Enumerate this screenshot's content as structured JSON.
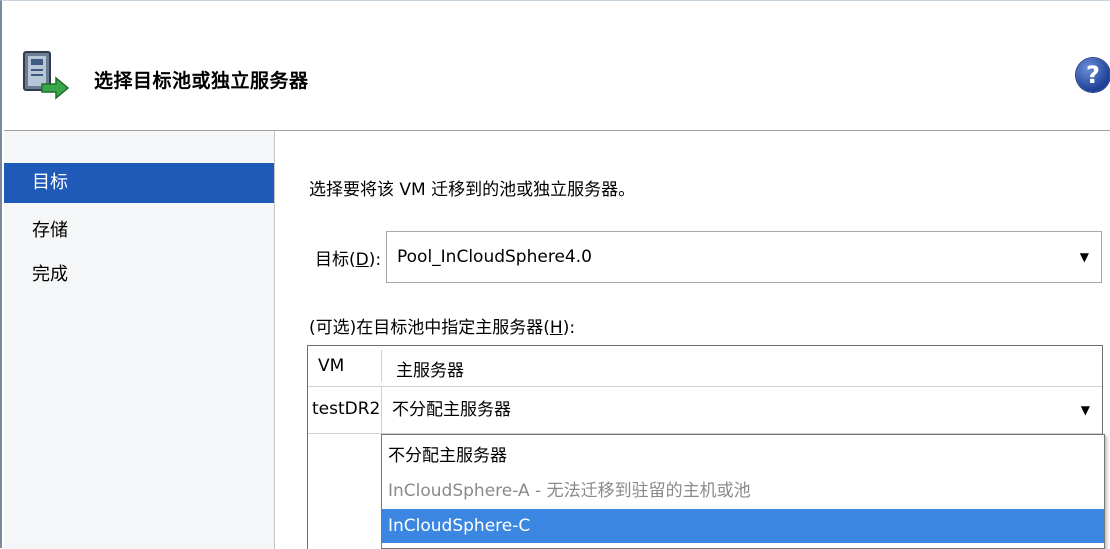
{
  "header": {
    "title": "选择目标池或独立服务器",
    "help_glyph": "?",
    "wizard_icon": "server-migrate-icon"
  },
  "sidebar": {
    "items": [
      {
        "label": "目标",
        "active": true
      },
      {
        "label": "存储",
        "active": false
      },
      {
        "label": "完成",
        "active": false
      }
    ]
  },
  "main": {
    "instruction": "选择要将该 VM 迁移到的池或独立服务器。",
    "target": {
      "label_prefix": "目标(",
      "label_key": "D",
      "label_suffix": "):",
      "value": "Pool_InCloudSphere4.0"
    },
    "optional": {
      "label_prefix": "(可选)在目标池中指定主服务器(",
      "label_key": "H",
      "label_suffix": "):"
    },
    "grid": {
      "columns": [
        "VM",
        "主服务器"
      ],
      "rows": [
        {
          "vm": "testDR2",
          "host": "不分配主服务器"
        }
      ]
    },
    "dropdown": {
      "options": [
        {
          "label": "不分配主服务器",
          "state": "normal"
        },
        {
          "label": "InCloudSphere-A - 无法迁移到驻留的主机或池",
          "state": "disabled"
        },
        {
          "label": "InCloudSphere-C",
          "state": "selected"
        }
      ]
    }
  },
  "colors": {
    "nav_active": "#1f5ab8",
    "option_selected": "#3a86e0",
    "option_disabled": "#8a8a8a"
  }
}
